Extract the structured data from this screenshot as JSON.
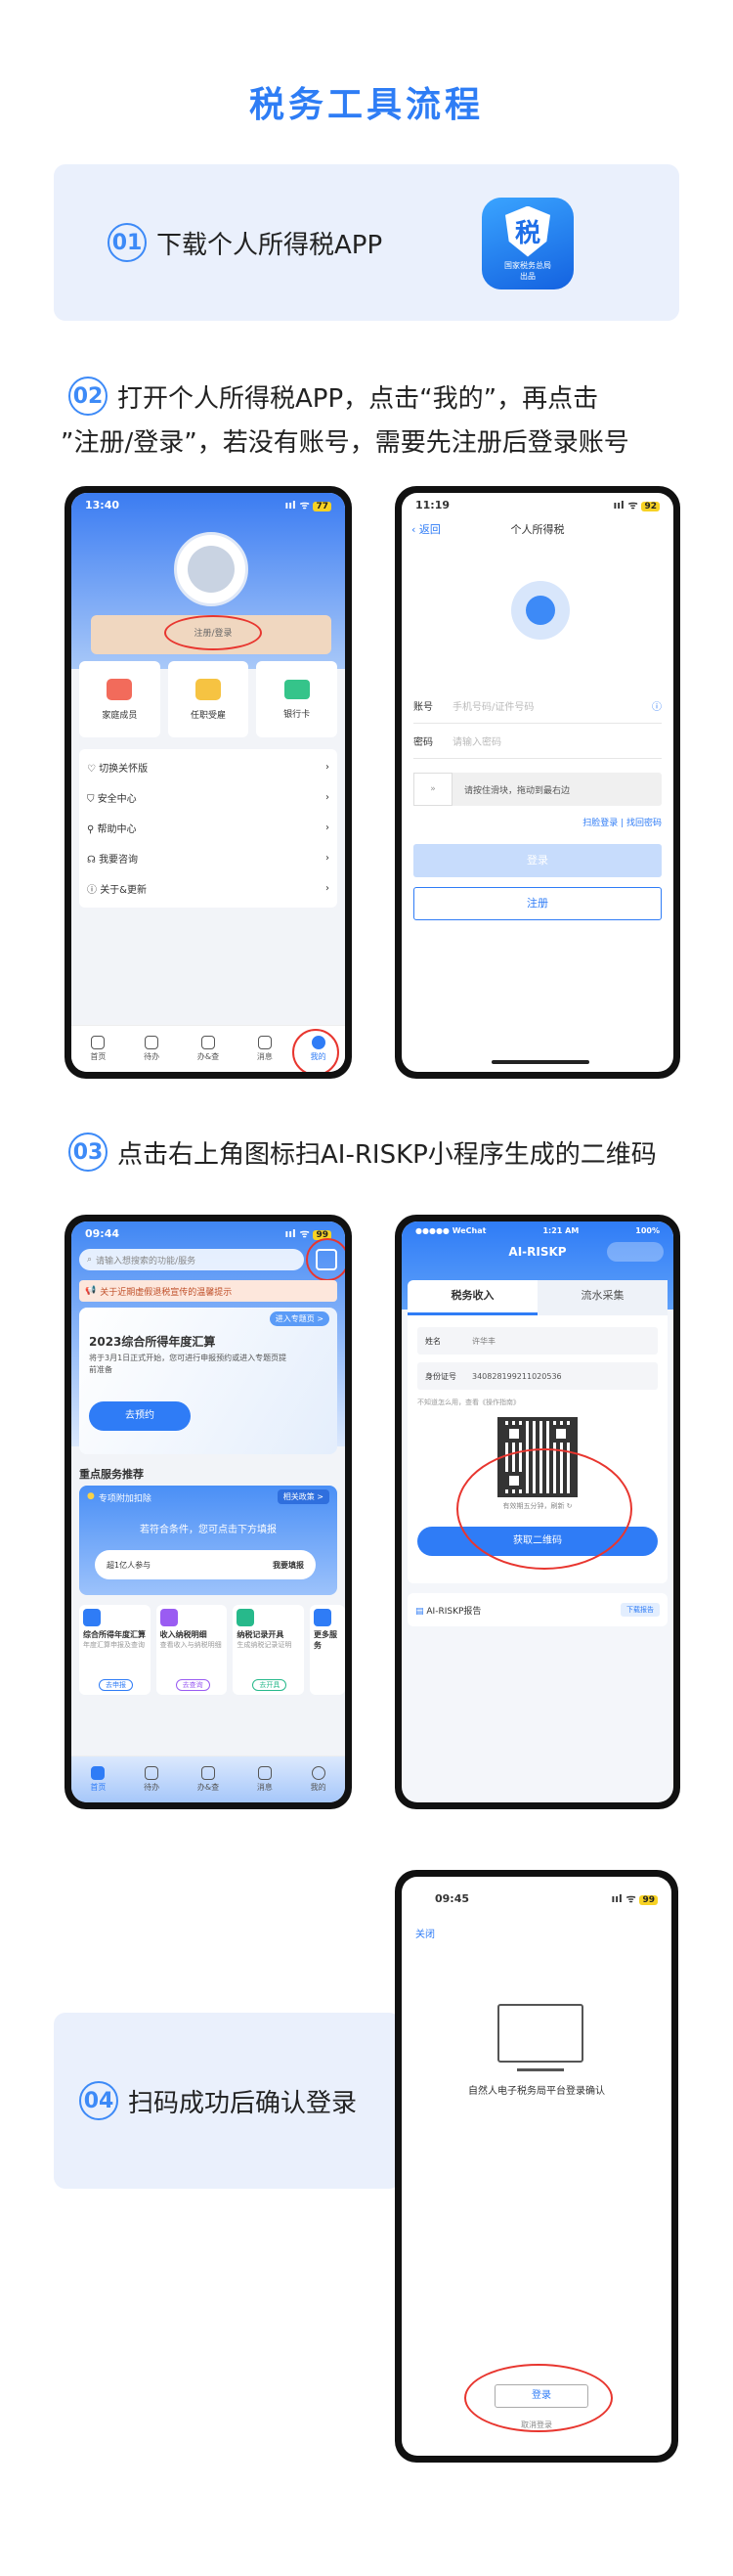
{
  "page_title": "税务工具流程",
  "step1": {
    "num": "01",
    "text": "下载个人所得税APP",
    "app_icon": {
      "char": "税",
      "label1": "国家税务总局",
      "label2": "出品"
    }
  },
  "step2": {
    "num": "02",
    "text_line1": "打开个人所得税APP，点击“我的”，再点击",
    "text_line2": "”注册/登录”，若没有账号，需要先注册后登录账号"
  },
  "phone1": {
    "time": "13:40",
    "battery": "77",
    "login_label": "注册/登录",
    "shortcuts": [
      "家庭成员",
      "任职受雇",
      "银行卡"
    ],
    "menu": [
      "切换关怀版",
      "安全中心",
      "帮助中心",
      "我要咨询",
      "关于&更新"
    ],
    "tabs": [
      "首页",
      "待办",
      "办&查",
      "消息",
      "我的"
    ]
  },
  "phone2": {
    "time": "11:19",
    "battery": "92",
    "back": "返回",
    "title": "个人所得税",
    "account_label": "账号",
    "account_placeholder": "手机号码/证件号码",
    "password_label": "密码",
    "password_placeholder": "请输入密码",
    "slider_text": "请按住滑块，拖动到最右边",
    "links": "扫脸登录 | 找回密码",
    "login_btn": "登录",
    "register_btn": "注册"
  },
  "step3": {
    "num": "03",
    "text": "点击右上角图标扫AI-RISKP小程序生成的二维码"
  },
  "phone3": {
    "time": "09:44",
    "battery": "99",
    "search_placeholder": "请输入想搜索的功能/服务",
    "notice": "关于近期虚假退税宣传的温馨提示",
    "banner_tag": "进入专题页 >",
    "banner_title": "2023综合所得年度汇算",
    "banner_desc": "将于3月1日正式开始，您可进行申报预约或进入专题页提前准备",
    "banner_btn": "去预约",
    "section_title": "重点服务推荐",
    "promo_title": "专项附加扣除",
    "promo_link": "相关政策 >",
    "promo_desc": "若符合条件，您可点击下方填报",
    "promo_people": "超1亿人参与",
    "promo_btn": "我要填报",
    "services": [
      {
        "name": "综合所得年度汇算",
        "desc": "年度汇算申报及查询",
        "btn": "去申报"
      },
      {
        "name": "收入纳税明细",
        "desc": "查看收入与纳税明细",
        "btn": "去查询"
      },
      {
        "name": "纳税记录开具",
        "desc": "生成纳税记录证明",
        "btn": "去开具"
      },
      {
        "name": "更多服务",
        "desc": "查看更多",
        "btn": ""
      }
    ],
    "tabs": [
      "首页",
      "待办",
      "办&查",
      "消息",
      "我的"
    ]
  },
  "phone4": {
    "status_left": "●●●●● WeChat",
    "time": "1:21 AM",
    "battery": "100%",
    "app_title": "AI-RISKP",
    "tab_active": "税务收入",
    "tab_other": "流水采集",
    "name_label": "姓名",
    "name_value": "许华丰",
    "id_label": "身份证号",
    "id_value": "340828199211020536",
    "help": "不知道怎么用，查看《操作指南》",
    "qr_caption": "有效期五分钟，刷新 ↻",
    "get_qr_btn": "获取二维码",
    "report_label": "AI-RISKP报告",
    "report_btn": "下载报告"
  },
  "step4": {
    "num": "04",
    "text": "扫码成功后确认登录"
  },
  "phone5": {
    "time": "09:45",
    "battery": "99",
    "close": "关闭",
    "confirm_text": "自然人电子税务局平台登录确认",
    "login_btn": "登录",
    "cancel": "取消登录"
  }
}
